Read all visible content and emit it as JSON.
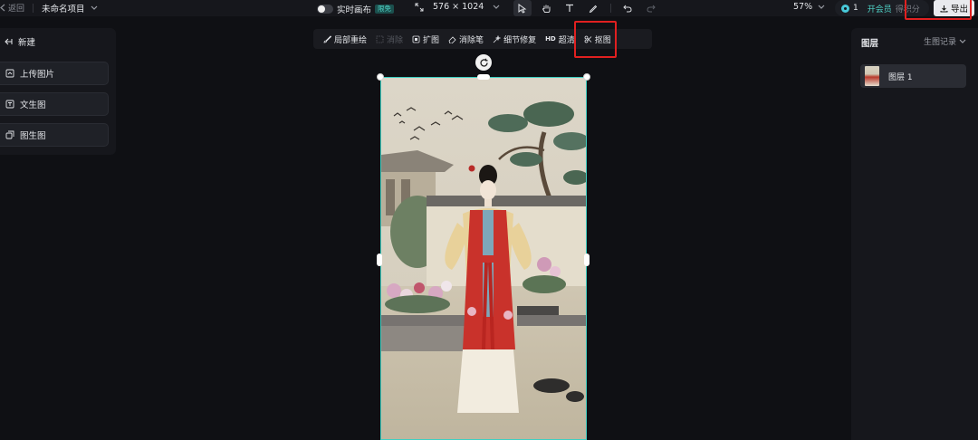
{
  "topbar": {
    "back_label": "返回",
    "project_name": "未命名项目",
    "realtime_label": "实时画布",
    "free_badge": "限免",
    "canvas_size": "576 × 1024",
    "zoom": "57%",
    "credits": "1",
    "member_label": "开会员",
    "earn_label": "得积分",
    "export_label": "导出"
  },
  "left_panel": {
    "title": "新建",
    "items": [
      {
        "label": "上传图片",
        "icon": "upload-image-icon"
      },
      {
        "label": "文生图",
        "icon": "text-to-image-icon"
      },
      {
        "label": "图生图",
        "icon": "image-to-image-icon"
      }
    ]
  },
  "right_panel": {
    "title": "图层",
    "history_label": "生图记录",
    "layers": [
      {
        "label": "图层 1"
      }
    ]
  },
  "canvas_toolbar": {
    "items": [
      {
        "label": "局部重绘",
        "icon": "brush-icon",
        "enabled": true
      },
      {
        "label": "消除",
        "icon": "erase-icon",
        "enabled": false
      },
      {
        "label": "扩图",
        "icon": "expand-icon",
        "enabled": true
      },
      {
        "label": "消除笔",
        "icon": "eraser-pen-icon",
        "enabled": true
      },
      {
        "label": "细节修复",
        "icon": "detail-repair-icon",
        "enabled": true
      },
      {
        "label": "超清",
        "icon": "hd-icon",
        "enabled": true
      },
      {
        "label": "抠图",
        "icon": "cutout-icon",
        "enabled": true
      }
    ]
  },
  "colors": {
    "accent_teal": "#3ecfc1",
    "highlight_red": "#e02020",
    "background": "#0f1014"
  }
}
